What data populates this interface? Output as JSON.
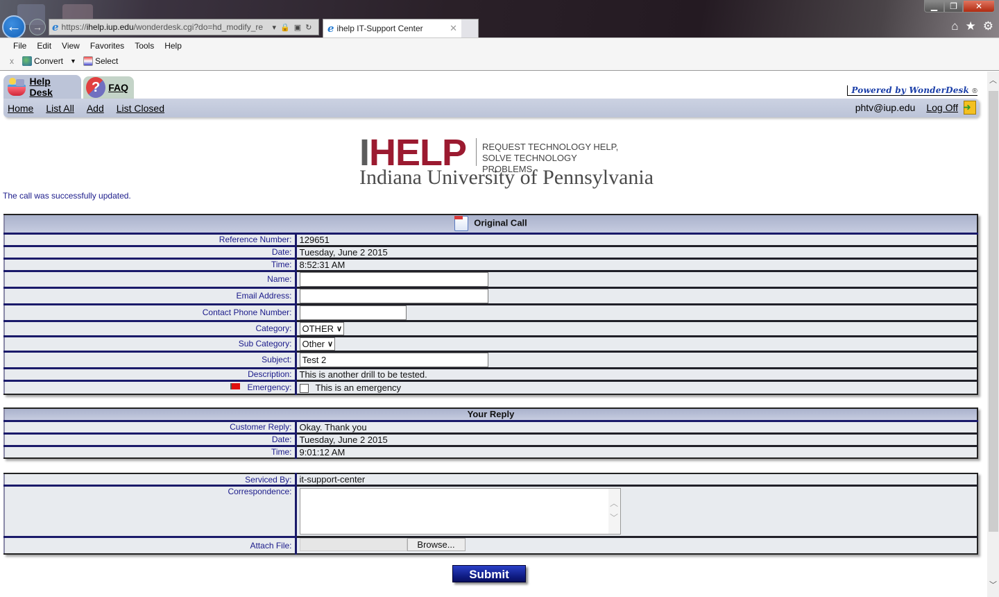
{
  "browser": {
    "url_prefix": "https://",
    "url_host": "ihelp.iup.edu",
    "url_path": "/wonderdesk.cgi?do=hd_modify_re",
    "tab_title": "ihelp IT-Support Center",
    "menu": [
      "File",
      "Edit",
      "View",
      "Favorites",
      "Tools",
      "Help"
    ],
    "command_bar": {
      "convert_label": "Convert",
      "select_label": "Select"
    }
  },
  "header": {
    "tabs": [
      {
        "label": "Help Desk",
        "icon": "help-desk-icon"
      },
      {
        "label": "FAQ",
        "icon": "question-icon"
      }
    ],
    "powered_by": "Powered by WonderDesk",
    "registered": "®",
    "nav_links": [
      "Home",
      "List All",
      "Add",
      "List Closed"
    ],
    "user_email": "phtv@iup.edu",
    "logoff_label": "Log Off"
  },
  "logo": {
    "brand_i": "I",
    "brand_rest": "HELP",
    "tagline_line1": "REQUEST TECHNOLOGY HELP,",
    "tagline_line2": "SOLVE TECHNOLOGY PROBLEMS",
    "university": "Indiana University of Pennsylvania"
  },
  "status_message": "The call was successfully updated.",
  "original_call": {
    "title": "Original Call",
    "reference_label": "Reference Number:",
    "reference_value": "129651",
    "date_label": "Date:",
    "date_value": "Tuesday, June 2 2015",
    "time_label": "Time:",
    "time_value": "8:52:31 AM",
    "name_label": "Name:",
    "name_value": "",
    "email_label": "Email Address:",
    "email_value": "",
    "phone_label": "Contact Phone Number:",
    "phone_value": "",
    "category_label": "Category:",
    "category_value": "OTHER",
    "subcategory_label": "Sub Category:",
    "subcategory_value": "Other",
    "subject_label": "Subject:",
    "subject_value": "Test 2",
    "description_label": "Description:",
    "description_value": "This is another drill to be tested.",
    "emergency_label": "Emergency:",
    "emergency_text": "This is an emergency",
    "emergency_checked": false
  },
  "your_reply": {
    "title": "Your Reply",
    "customer_reply_label": "Customer Reply:",
    "customer_reply_value": "Okay. Thank you",
    "date_label": "Date:",
    "date_value": "Tuesday, June 2 2015",
    "time_label": "Time:",
    "time_value": "9:01:12 AM"
  },
  "service": {
    "serviced_by_label": "Serviced By:",
    "serviced_by_value": "it-support-center",
    "correspondence_label": "Correspondence:",
    "correspondence_value": "",
    "attach_label": "Attach File:",
    "browse_label": "Browse..."
  },
  "submit_label": "Submit"
}
